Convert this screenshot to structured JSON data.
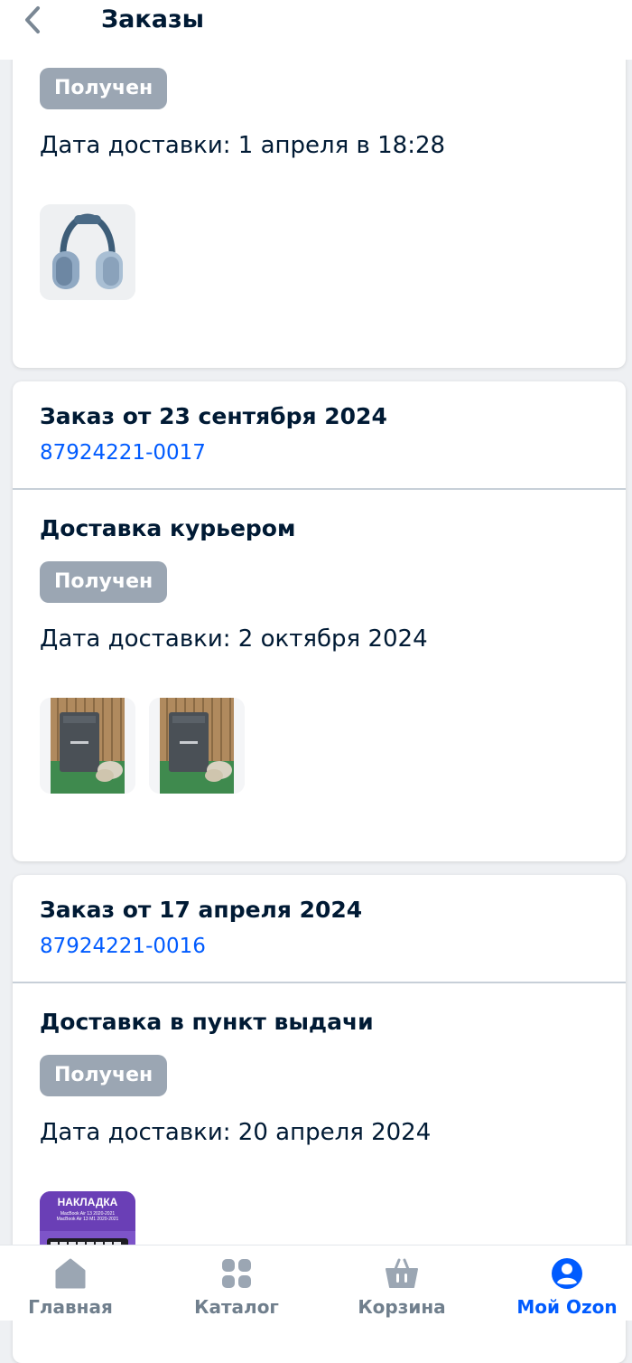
{
  "header": {
    "title": "Заказы"
  },
  "orders": [
    {
      "status": "Получен",
      "delivery_date": "Дата доставки: 1 апреля в 18:28",
      "items": [
        "headphones-image"
      ]
    },
    {
      "title": "Заказ от 23 сентября 2024",
      "number": "87924221-0017",
      "delivery_type": "Доставка курьером",
      "status": "Получен",
      "delivery_date": "Дата доставки: 2 октября 2024",
      "items": [
        "stove-image",
        "stove-image"
      ]
    },
    {
      "title": "Заказ от 17 апреля 2024",
      "number": "87924221-0016",
      "delivery_type": "Доставка в пункт выдачи",
      "status": "Получен",
      "delivery_date": "Дата доставки: 20 апреля 2024",
      "items": [
        "keyboard-cover-image"
      ],
      "item_text": {
        "line1": "НАКЛАДКА",
        "line2": "MacBook Air 13 2020-2021",
        "line3": "MacBook Air 13 M1 2020-2021"
      }
    }
  ],
  "tabbar": {
    "home": "Главная",
    "catalog": "Каталог",
    "cart": "Корзина",
    "profile": "Мой Ozon"
  },
  "colors": {
    "accent": "#005bff",
    "badge": "#9ba6b3",
    "text": "#001a34",
    "muted": "#707f8d"
  }
}
